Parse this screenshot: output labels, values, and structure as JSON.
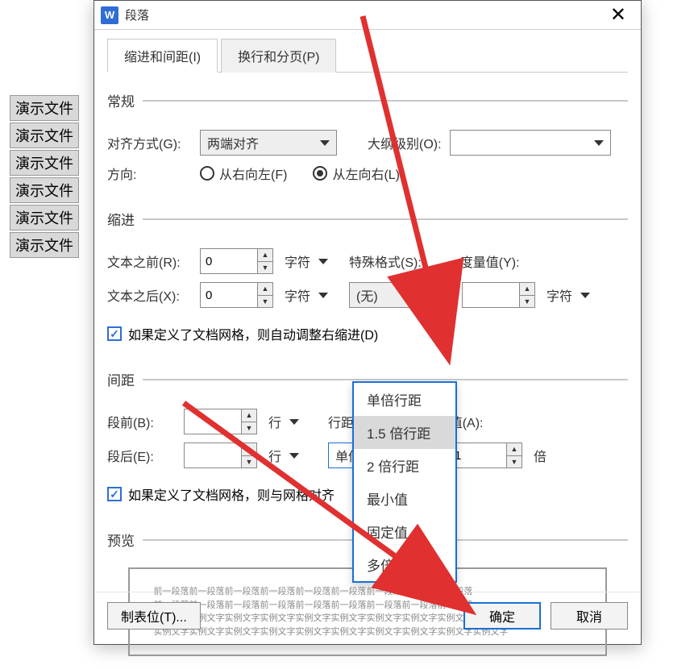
{
  "background_items": [
    "演示文件",
    "演示文件",
    "演示文件",
    "演示文件",
    "演示文件",
    "演示文件"
  ],
  "dialog": {
    "app_icon": "W",
    "title": "段落",
    "tabs": {
      "indent": "缩进和间距(I)",
      "pagination": "换行和分页(P)",
      "active": 0
    },
    "sections": {
      "general": {
        "legend": "常规",
        "alignment_label": "对齐方式(G):",
        "alignment_value": "两端对齐",
        "outline_label": "大纲级别(O):",
        "outline_value": "",
        "direction_label": "方向:",
        "rtl_label": "从右向左(F)",
        "ltr_label": "从左向右(L)",
        "direction_selected": "ltr"
      },
      "indent": {
        "legend": "缩进",
        "before_label": "文本之前(R):",
        "before_value": "0",
        "before_unit": "字符",
        "after_label": "文本之后(X):",
        "after_value": "0",
        "after_unit": "字符",
        "special_label": "特殊格式(S):",
        "special_value": "(无)",
        "measure_label": "度量值(Y):",
        "measure_value": "",
        "measure_unit": "字符",
        "grid_check": "如果定义了文档网格，则自动调整右缩进(D)"
      },
      "spacing": {
        "legend": "间距",
        "before_label": "段前(B):",
        "before_value": "",
        "before_unit": "行",
        "after_label": "段后(E):",
        "after_value": "",
        "after_unit": "行",
        "line_spacing_label": "行距(N):",
        "line_spacing_value": "单倍行距",
        "set_value_label": "设置值(A):",
        "set_value": "1",
        "set_value_unit": "倍",
        "grid_check": "如果定义了文档网格，则与网格对齐",
        "options": [
          "单倍行距",
          "1.5 倍行距",
          "2 倍行距",
          "最小值",
          "固定值",
          "多倍行距"
        ],
        "hover_index": 1
      },
      "preview": {
        "legend": "预览",
        "lines": [
          "前一段落前一段落前一段落前一段落前一段落前一段落前一段落前一段落前一段落",
          "前一段落前一段落前一段落前一段落前一段落前一段落前一段落前一段落前一段落",
          "实例文字实例文字实例文字实例文字实例文字实例文字实例文字实例文字实例文字实例文字",
          "实例文字实例文字实例文字实例文字实例文字实例文字实例文字实例文字实例文字实例文字"
        ]
      }
    },
    "footer": {
      "tabs_btn": "制表位(T)...",
      "ok": "确定",
      "cancel": "取消"
    }
  }
}
